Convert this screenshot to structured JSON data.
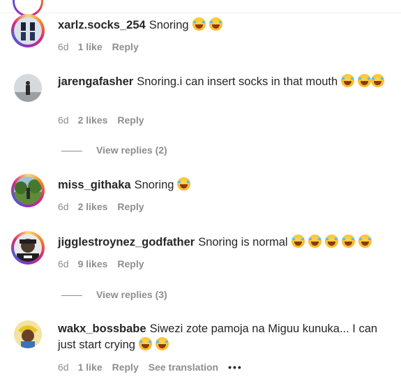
{
  "comments": [
    {
      "username": "xarlz.socks_254",
      "text": "Snoring",
      "time": "6d",
      "likes": "1 like",
      "reply": "Reply"
    },
    {
      "username": "jarengafasher",
      "text": "Snoring.i can insert socks in that mouth",
      "time": "6d",
      "likes": "2 likes",
      "reply": "Reply",
      "view_replies": "View replies (2)"
    },
    {
      "username": "miss_githaka",
      "text": "Snoring",
      "time": "6d",
      "likes": "2 likes",
      "reply": "Reply"
    },
    {
      "username": "jigglestroynez_godfather",
      "text": "Snoring is normal",
      "time": "6d",
      "likes": "9 likes",
      "reply": "Reply",
      "view_replies": "View replies (3)"
    },
    {
      "username": "wakx_bossbabe",
      "text": "Siwezi zote pamoja na Miguu kunuka... I can just start crying",
      "time": "6d",
      "likes": "1 like",
      "reply": "Reply",
      "see_translation": "See translation",
      "more": "•••"
    }
  ],
  "icons": {
    "emoji": "face-with-tears-of-joy-icon"
  },
  "colors": {
    "text": "#262626",
    "secondary": "#8e8e8e",
    "story_ring": "#d62976"
  }
}
